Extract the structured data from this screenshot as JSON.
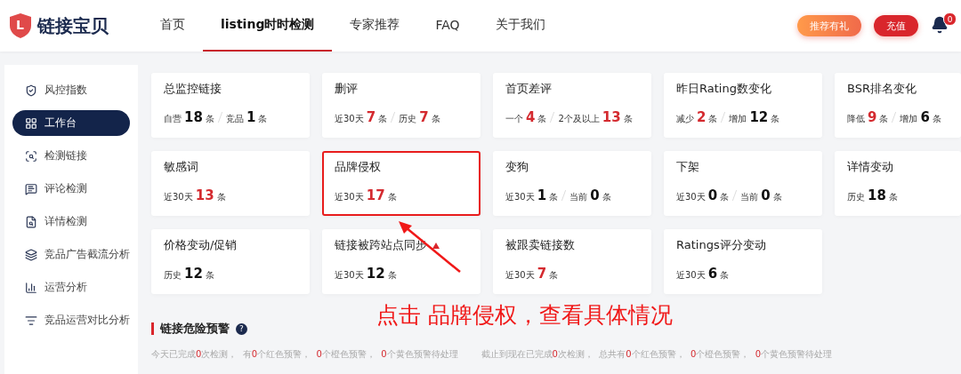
{
  "brand": {
    "name": "链接宝贝",
    "logo_letter": "L"
  },
  "nav": [
    {
      "label": "首页",
      "selected": false
    },
    {
      "label": "listing时时检测",
      "selected": true
    },
    {
      "label": "专家推荐",
      "selected": false
    },
    {
      "label": "FAQ",
      "selected": false
    },
    {
      "label": "关于我们",
      "selected": false
    }
  ],
  "actions": {
    "referral": "推荐有礼",
    "recharge": "充值",
    "notifications": "0"
  },
  "sidebar": [
    {
      "label": "风控指数",
      "selected": false
    },
    {
      "label": "工作台",
      "selected": true
    },
    {
      "label": "检测链接",
      "selected": false
    },
    {
      "label": "评论检测",
      "selected": false
    },
    {
      "label": "详情检测",
      "selected": false
    },
    {
      "label": "竞品广告截流分析",
      "selected": false
    },
    {
      "label": "运营分析",
      "selected": false
    },
    {
      "label": "竞品运营对比分析",
      "selected": false
    }
  ],
  "cards": [
    {
      "title": "总监控链接",
      "alert": false,
      "highlighted": false,
      "stats": [
        {
          "label": "自营",
          "value": "18",
          "unit": "条",
          "highlight": false
        },
        {
          "label": "竞品",
          "value": "1",
          "unit": "条",
          "highlight": false
        }
      ]
    },
    {
      "title": "删评",
      "alert": false,
      "highlighted": false,
      "stats": [
        {
          "label": "近30天",
          "value": "7",
          "unit": "条",
          "highlight": true
        },
        {
          "label": "历史",
          "value": "7",
          "unit": "条",
          "highlight": true
        }
      ]
    },
    {
      "title": "首页差评",
      "alert": false,
      "highlighted": false,
      "stats": [
        {
          "label": "一个",
          "value": "4",
          "unit": "条",
          "highlight": true
        },
        {
          "label": "2个及以上",
          "value": "13",
          "unit": "条",
          "highlight": true
        }
      ]
    },
    {
      "title": "昨日Rating数变化",
      "alert": false,
      "highlighted": false,
      "stats": [
        {
          "label": "减少",
          "value": "2",
          "unit": "条",
          "highlight": true
        },
        {
          "label": "增加",
          "value": "12",
          "unit": "条",
          "highlight": false
        }
      ]
    },
    {
      "title": "BSR排名变化",
      "alert": false,
      "highlighted": false,
      "stats": [
        {
          "label": "降低",
          "value": "9",
          "unit": "条",
          "highlight": true
        },
        {
          "label": "增加",
          "value": "6",
          "unit": "条",
          "highlight": false
        }
      ]
    },
    {
      "title": "敏感词",
      "alert": false,
      "highlighted": false,
      "stats": [
        {
          "label": "近30天",
          "value": "13",
          "unit": "条",
          "highlight": true
        }
      ]
    },
    {
      "title": "品牌侵权",
      "alert": false,
      "highlighted": true,
      "stats": [
        {
          "label": "近30天",
          "value": "17",
          "unit": "条",
          "highlight": true
        }
      ]
    },
    {
      "title": "变狗",
      "alert": false,
      "highlighted": false,
      "stats": [
        {
          "label": "近30天",
          "value": "1",
          "unit": "条",
          "highlight": false
        },
        {
          "label": "当前",
          "value": "0",
          "unit": "条",
          "highlight": false
        }
      ]
    },
    {
      "title": "下架",
      "alert": false,
      "highlighted": false,
      "stats": [
        {
          "label": "近30天",
          "value": "0",
          "unit": "条",
          "highlight": false
        },
        {
          "label": "当前",
          "value": "0",
          "unit": "条",
          "highlight": false
        }
      ]
    },
    {
      "title": "详情变动",
      "alert": false,
      "highlighted": false,
      "stats": [
        {
          "label": "历史",
          "value": "18",
          "unit": "条",
          "highlight": false
        }
      ]
    },
    {
      "title": "价格变动/促销",
      "alert": false,
      "highlighted": false,
      "stats": [
        {
          "label": "历史",
          "value": "12",
          "unit": "条",
          "highlight": false
        }
      ]
    },
    {
      "title": "链接被跨站点同步",
      "alert": true,
      "highlighted": false,
      "stats": [
        {
          "label": "近30天",
          "value": "12",
          "unit": "条",
          "highlight": false
        }
      ]
    },
    {
      "title": "被跟卖链接数",
      "alert": false,
      "highlighted": false,
      "stats": [
        {
          "label": "近30天",
          "value": "7",
          "unit": "条",
          "highlight": true
        }
      ]
    },
    {
      "title": "Ratings评分变动",
      "alert": false,
      "highlighted": false,
      "stats": [
        {
          "label": "近30天",
          "value": "6",
          "unit": "条",
          "highlight": false
        }
      ]
    }
  ],
  "callout": "点击 品牌侵权，查看具体情况",
  "warnings": {
    "title": "链接危险预警",
    "help": "?",
    "summaries": [
      [
        {
          "text": "今天已完成",
          "highlight": false
        },
        {
          "text": "0",
          "highlight": true
        },
        {
          "text": "次检测，  有",
          "highlight": false
        },
        {
          "text": "0",
          "highlight": true
        },
        {
          "text": "个红色预警，  ",
          "highlight": false
        },
        {
          "text": "0",
          "highlight": true
        },
        {
          "text": "个橙色预警，  ",
          "highlight": false
        },
        {
          "text": "0",
          "highlight": true
        },
        {
          "text": "个黄色预警待处理",
          "highlight": false
        }
      ],
      [
        {
          "text": "截止到现在已完成",
          "highlight": false
        },
        {
          "text": "0",
          "highlight": true
        },
        {
          "text": "次检测，  总共有",
          "highlight": false
        },
        {
          "text": "0",
          "highlight": true
        },
        {
          "text": "个红色预警，  ",
          "highlight": false
        },
        {
          "text": "0",
          "highlight": true
        },
        {
          "text": "个橙色预警，  ",
          "highlight": false
        },
        {
          "text": "0",
          "highlight": true
        },
        {
          "text": "个黄色预警待处理",
          "highlight": false
        }
      ]
    ]
  }
}
